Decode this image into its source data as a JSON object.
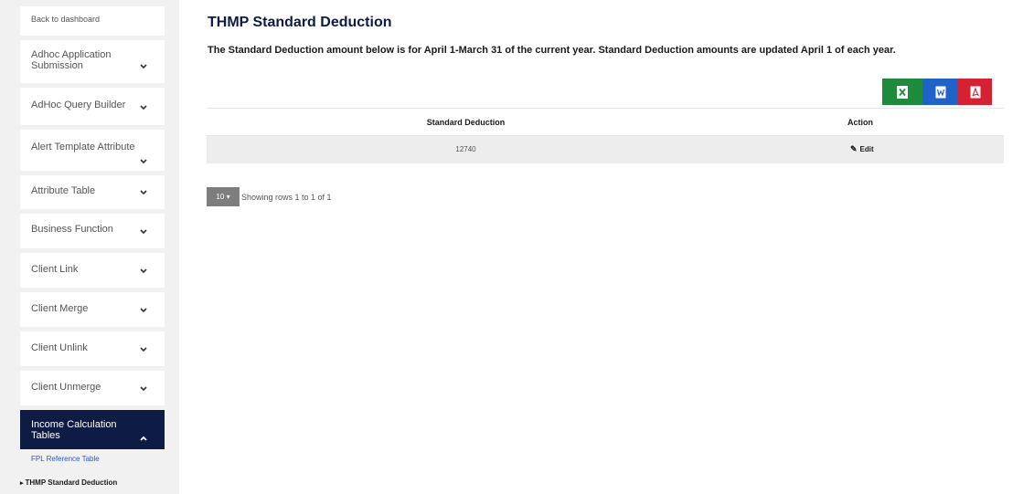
{
  "sidebar": {
    "back_label": "Back to dashboard",
    "items": [
      {
        "label": "Adhoc Application Submission"
      },
      {
        "label": "AdHoc Query Builder"
      },
      {
        "label": "Alert Template Attribute"
      },
      {
        "label": "Attribute Table"
      },
      {
        "label": "Business Function"
      },
      {
        "label": "Client Link"
      },
      {
        "label": "Client Merge"
      },
      {
        "label": "Client Unlink"
      },
      {
        "label": "Client Unmerge"
      },
      {
        "label": "Income Calculation Tables"
      }
    ],
    "submenu": {
      "link": "FPL Reference Table",
      "current": "THMP Standard Deduction"
    }
  },
  "main": {
    "title": "THMP Standard Deduction",
    "description": "The Standard Deduction amount below is for April 1-March 31 of the current year. Standard Deduction amounts are updated April 1 of each year.",
    "table": {
      "headers": [
        "Standard Deduction",
        "Action"
      ],
      "rows": [
        {
          "standard_deduction": "12740",
          "action": "Edit"
        }
      ]
    },
    "pager": {
      "page_size": "10",
      "info": "Showing rows 1 to 1 of 1"
    }
  },
  "colors": {
    "nav_active": "#0e1b45",
    "excel": "#1d8a3c",
    "word": "#1f63c9",
    "pdf": "#d52131",
    "link": "#2d56c9"
  }
}
